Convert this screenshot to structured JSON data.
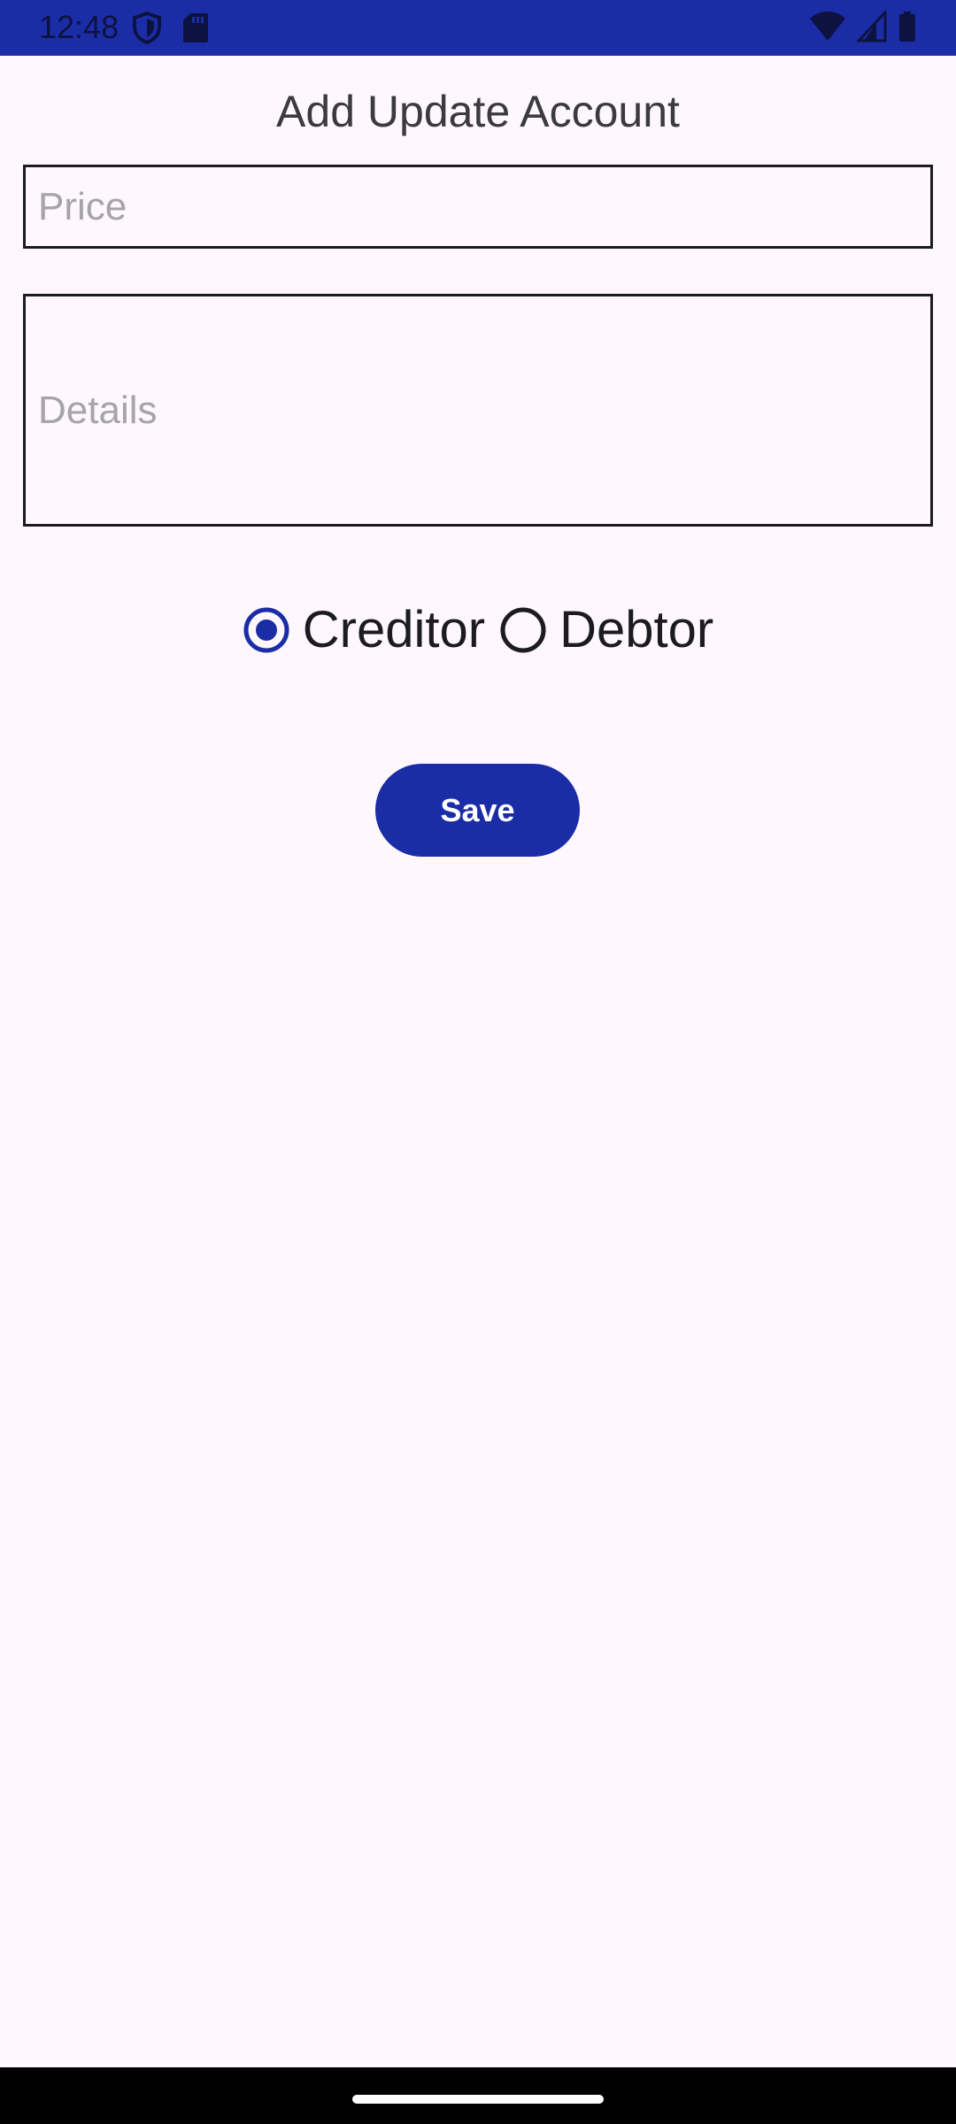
{
  "status_bar": {
    "time": "12:48",
    "icons_left": [
      "vpn-shield-icon",
      "sd-card-icon"
    ],
    "icons_right": [
      "wifi-icon",
      "cell-signal-icon",
      "battery-icon"
    ],
    "background": "#1A2DA6"
  },
  "screen": {
    "title": "Add Update Account"
  },
  "form": {
    "price": {
      "placeholder": "Price",
      "value": ""
    },
    "details": {
      "placeholder": "Details",
      "value": ""
    },
    "account_type": {
      "options": [
        {
          "label": "Creditor",
          "selected": true
        },
        {
          "label": "Debtor",
          "selected": false
        }
      ]
    },
    "save_label": "Save"
  },
  "colors": {
    "accent": "#1A2DA6",
    "background": "#FEF7FD",
    "text": "#1C1B1F",
    "placeholder": "#A6A4A8"
  }
}
